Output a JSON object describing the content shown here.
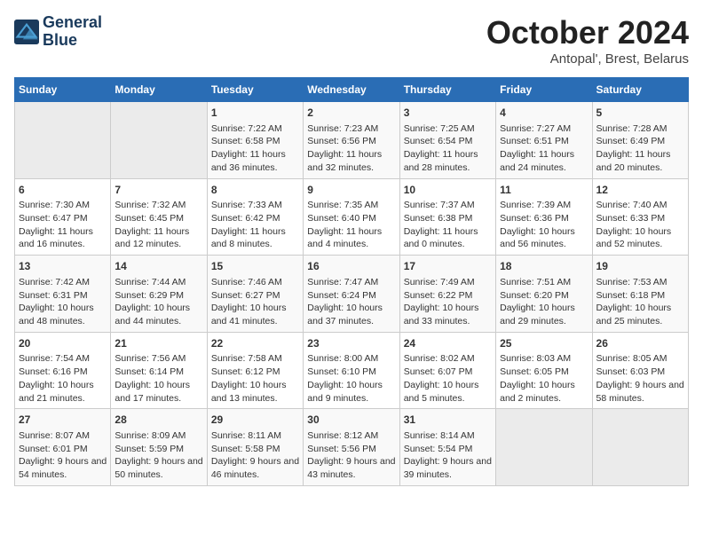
{
  "header": {
    "logo_line1": "General",
    "logo_line2": "Blue",
    "month": "October 2024",
    "location": "Antopal', Brest, Belarus"
  },
  "weekdays": [
    "Sunday",
    "Monday",
    "Tuesday",
    "Wednesday",
    "Thursday",
    "Friday",
    "Saturday"
  ],
  "weeks": [
    [
      {
        "day": "",
        "data": ""
      },
      {
        "day": "",
        "data": ""
      },
      {
        "day": "1",
        "data": "Sunrise: 7:22 AM\nSunset: 6:58 PM\nDaylight: 11 hours and 36 minutes."
      },
      {
        "day": "2",
        "data": "Sunrise: 7:23 AM\nSunset: 6:56 PM\nDaylight: 11 hours and 32 minutes."
      },
      {
        "day": "3",
        "data": "Sunrise: 7:25 AM\nSunset: 6:54 PM\nDaylight: 11 hours and 28 minutes."
      },
      {
        "day": "4",
        "data": "Sunrise: 7:27 AM\nSunset: 6:51 PM\nDaylight: 11 hours and 24 minutes."
      },
      {
        "day": "5",
        "data": "Sunrise: 7:28 AM\nSunset: 6:49 PM\nDaylight: 11 hours and 20 minutes."
      }
    ],
    [
      {
        "day": "6",
        "data": "Sunrise: 7:30 AM\nSunset: 6:47 PM\nDaylight: 11 hours and 16 minutes."
      },
      {
        "day": "7",
        "data": "Sunrise: 7:32 AM\nSunset: 6:45 PM\nDaylight: 11 hours and 12 minutes."
      },
      {
        "day": "8",
        "data": "Sunrise: 7:33 AM\nSunset: 6:42 PM\nDaylight: 11 hours and 8 minutes."
      },
      {
        "day": "9",
        "data": "Sunrise: 7:35 AM\nSunset: 6:40 PM\nDaylight: 11 hours and 4 minutes."
      },
      {
        "day": "10",
        "data": "Sunrise: 7:37 AM\nSunset: 6:38 PM\nDaylight: 11 hours and 0 minutes."
      },
      {
        "day": "11",
        "data": "Sunrise: 7:39 AM\nSunset: 6:36 PM\nDaylight: 10 hours and 56 minutes."
      },
      {
        "day": "12",
        "data": "Sunrise: 7:40 AM\nSunset: 6:33 PM\nDaylight: 10 hours and 52 minutes."
      }
    ],
    [
      {
        "day": "13",
        "data": "Sunrise: 7:42 AM\nSunset: 6:31 PM\nDaylight: 10 hours and 48 minutes."
      },
      {
        "day": "14",
        "data": "Sunrise: 7:44 AM\nSunset: 6:29 PM\nDaylight: 10 hours and 44 minutes."
      },
      {
        "day": "15",
        "data": "Sunrise: 7:46 AM\nSunset: 6:27 PM\nDaylight: 10 hours and 41 minutes."
      },
      {
        "day": "16",
        "data": "Sunrise: 7:47 AM\nSunset: 6:24 PM\nDaylight: 10 hours and 37 minutes."
      },
      {
        "day": "17",
        "data": "Sunrise: 7:49 AM\nSunset: 6:22 PM\nDaylight: 10 hours and 33 minutes."
      },
      {
        "day": "18",
        "data": "Sunrise: 7:51 AM\nSunset: 6:20 PM\nDaylight: 10 hours and 29 minutes."
      },
      {
        "day": "19",
        "data": "Sunrise: 7:53 AM\nSunset: 6:18 PM\nDaylight: 10 hours and 25 minutes."
      }
    ],
    [
      {
        "day": "20",
        "data": "Sunrise: 7:54 AM\nSunset: 6:16 PM\nDaylight: 10 hours and 21 minutes."
      },
      {
        "day": "21",
        "data": "Sunrise: 7:56 AM\nSunset: 6:14 PM\nDaylight: 10 hours and 17 minutes."
      },
      {
        "day": "22",
        "data": "Sunrise: 7:58 AM\nSunset: 6:12 PM\nDaylight: 10 hours and 13 minutes."
      },
      {
        "day": "23",
        "data": "Sunrise: 8:00 AM\nSunset: 6:10 PM\nDaylight: 10 hours and 9 minutes."
      },
      {
        "day": "24",
        "data": "Sunrise: 8:02 AM\nSunset: 6:07 PM\nDaylight: 10 hours and 5 minutes."
      },
      {
        "day": "25",
        "data": "Sunrise: 8:03 AM\nSunset: 6:05 PM\nDaylight: 10 hours and 2 minutes."
      },
      {
        "day": "26",
        "data": "Sunrise: 8:05 AM\nSunset: 6:03 PM\nDaylight: 9 hours and 58 minutes."
      }
    ],
    [
      {
        "day": "27",
        "data": "Sunrise: 8:07 AM\nSunset: 6:01 PM\nDaylight: 9 hours and 54 minutes."
      },
      {
        "day": "28",
        "data": "Sunrise: 8:09 AM\nSunset: 5:59 PM\nDaylight: 9 hours and 50 minutes."
      },
      {
        "day": "29",
        "data": "Sunrise: 8:11 AM\nSunset: 5:58 PM\nDaylight: 9 hours and 46 minutes."
      },
      {
        "day": "30",
        "data": "Sunrise: 8:12 AM\nSunset: 5:56 PM\nDaylight: 9 hours and 43 minutes."
      },
      {
        "day": "31",
        "data": "Sunrise: 8:14 AM\nSunset: 5:54 PM\nDaylight: 9 hours and 39 minutes."
      },
      {
        "day": "",
        "data": ""
      },
      {
        "day": "",
        "data": ""
      }
    ]
  ]
}
